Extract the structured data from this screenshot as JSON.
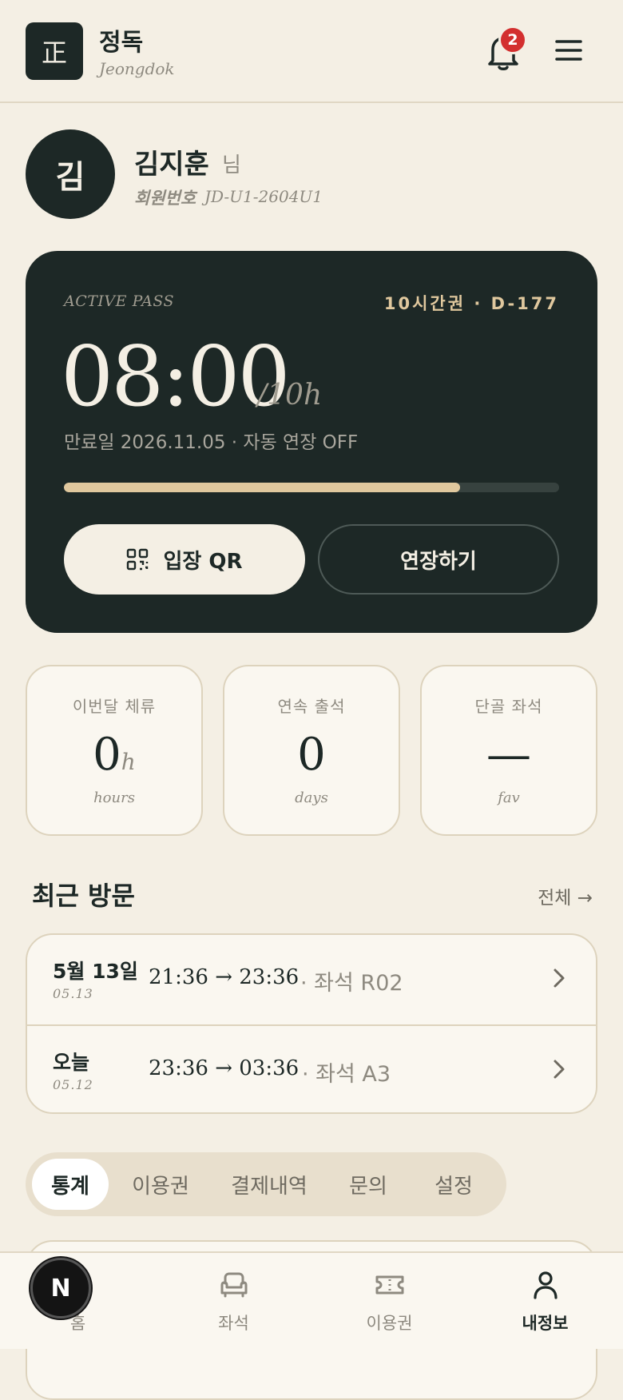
{
  "header": {
    "logo_glyph": "正",
    "brand_name": "정독",
    "brand_sub": "Jeongdok",
    "notification_count": "2"
  },
  "profile": {
    "avatar_initial": "김",
    "name": "김지훈",
    "suffix": "님",
    "member_label": "회원번호",
    "member_no": "JD-U1-2604U1"
  },
  "pass": {
    "label": "ACTIVE PASS",
    "type": "10시간권 · D-177",
    "time_left": "08:00",
    "total": "/10h",
    "expire": "만료일 2026.11.05 · 자동 연장 OFF",
    "progress_percent": 80,
    "qr_button": "입장 QR",
    "extend_button": "연장하기",
    "accent_color": "#e0c89e"
  },
  "stats": [
    {
      "label": "이번달 체류",
      "value": "0",
      "unit": "h",
      "sub": "hours"
    },
    {
      "label": "연속 출석",
      "value": "0",
      "unit": "",
      "sub": "days"
    },
    {
      "label": "단골 좌석",
      "value": "—",
      "unit": "",
      "sub": "fav"
    }
  ],
  "recent": {
    "title": "최근 방문",
    "see_all": "전체 →",
    "visits": [
      {
        "date": "5월 13일",
        "date_sub": "05.13",
        "time": "21:36 → 23:36",
        "seat": "· 좌석 R02"
      },
      {
        "date": "오늘",
        "date_sub": "05.12",
        "time": "23:36 → 03:36",
        "seat": "· 좌석 A3"
      }
    ]
  },
  "tabs": [
    {
      "label": "통계",
      "active": true
    },
    {
      "label": "이용권",
      "active": false
    },
    {
      "label": "결제내역",
      "active": false
    },
    {
      "label": "문의",
      "active": false
    },
    {
      "label": "설정",
      "active": false
    }
  ],
  "bottom_nav": [
    {
      "label": "홈",
      "icon": "home-icon",
      "active": false
    },
    {
      "label": "좌석",
      "icon": "seat-icon",
      "active": false
    },
    {
      "label": "이용권",
      "icon": "ticket-icon",
      "active": false
    },
    {
      "label": "내정보",
      "icon": "user-icon",
      "active": true
    }
  ],
  "fab": {
    "letter": "N"
  }
}
